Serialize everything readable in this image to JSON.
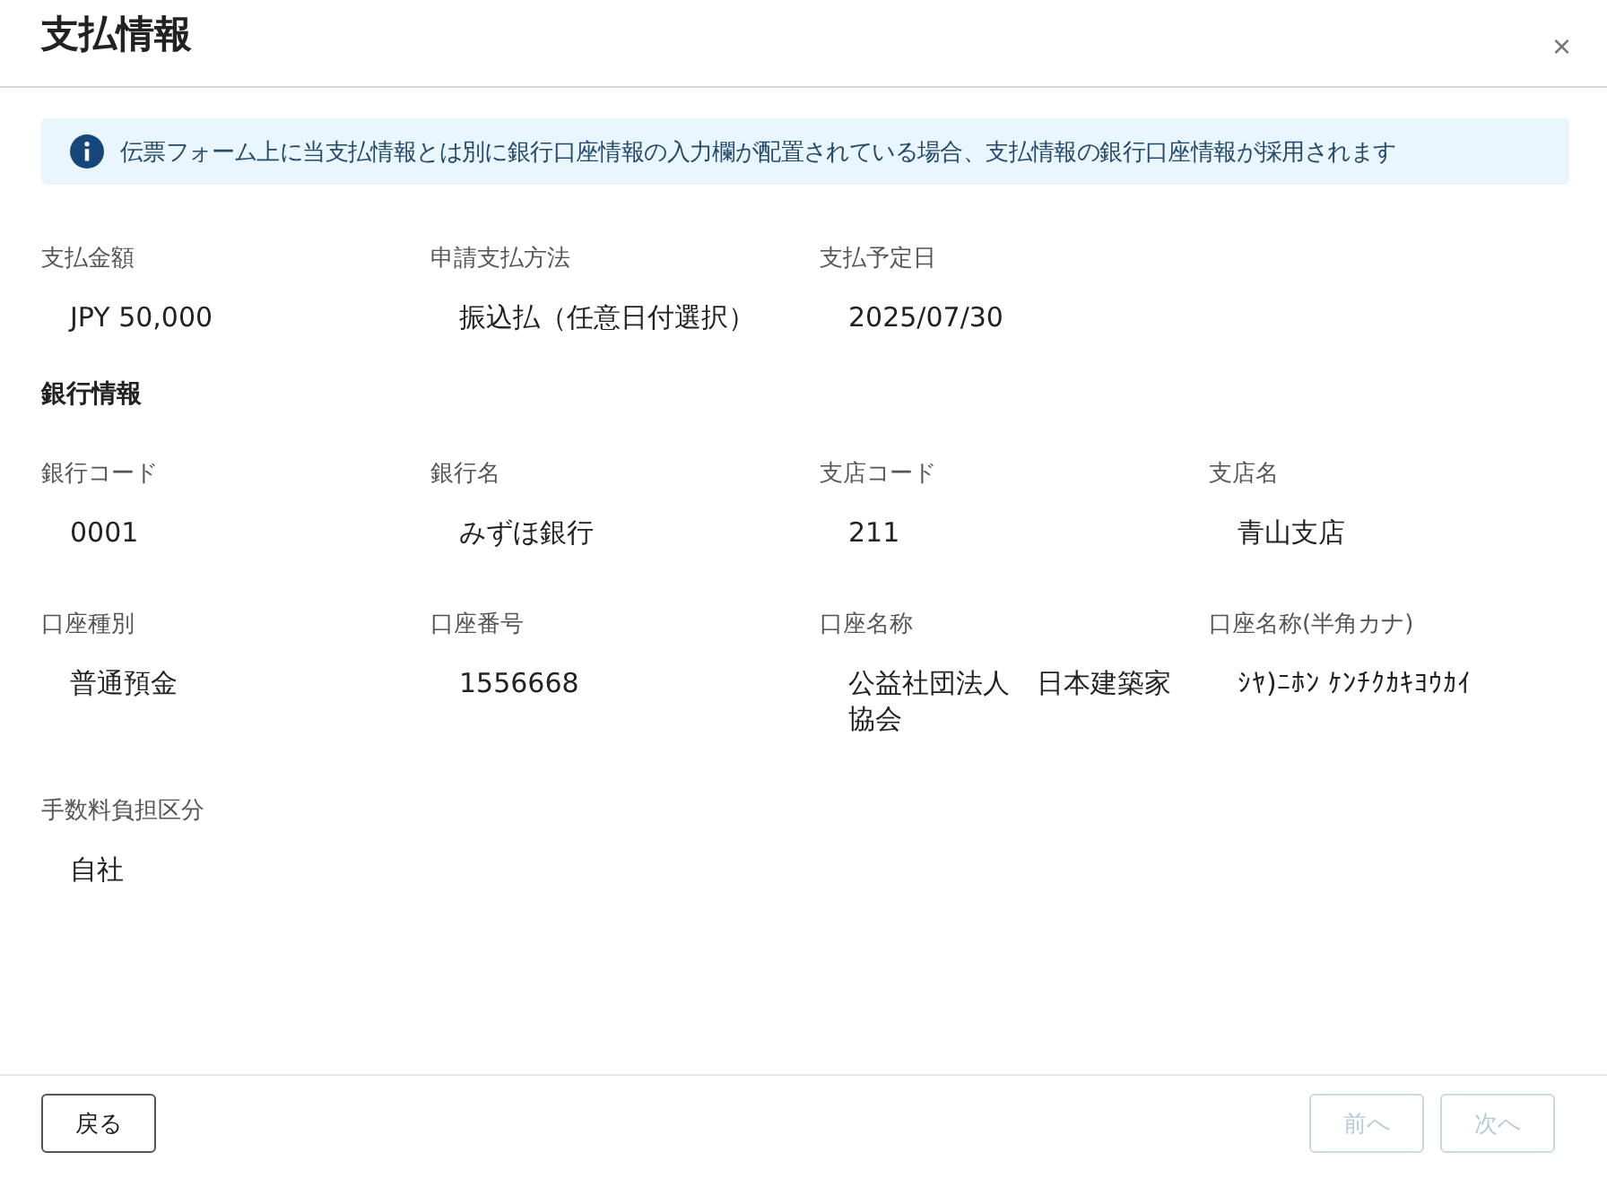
{
  "dialog": {
    "title": "支払情報",
    "close": "×"
  },
  "notice": {
    "text": "伝票フォーム上に当支払情報とは別に銀行口座情報の入力欄が配置されている場合、支払情報の銀行口座情報が採用されます"
  },
  "payment_fields": [
    {
      "label": "支払金額",
      "value": "JPY 50,000"
    },
    {
      "label": "申請支払方法",
      "value": "振込払（任意日付選択）"
    },
    {
      "label": "支払予定日",
      "value": "2025/07/30"
    }
  ],
  "bank_section": {
    "title": "銀行情報",
    "rows": [
      [
        {
          "label": "銀行コード",
          "value": "0001"
        },
        {
          "label": "銀行名",
          "value": "みずほ銀行"
        },
        {
          "label": "支店コード",
          "value": "211"
        },
        {
          "label": "支店名",
          "value": "青山支店"
        }
      ],
      [
        {
          "label": "口座種別",
          "value": "普通預金"
        },
        {
          "label": "口座番号",
          "value": "1556668"
        },
        {
          "label": "口座名称",
          "value": "公益社団法人　日本建築家協会"
        },
        {
          "label": "口座名称(半角カナ)",
          "value": "ｼﾔ)ﾆﾎﾝ ｹﾝﾁｸｶｷﾖｳｶｲ"
        }
      ],
      [
        {
          "label": "手数料負担区分",
          "value": "自社"
        }
      ]
    ]
  },
  "footer": {
    "back": {
      "label": "戻る",
      "disabled": false
    },
    "nav": [
      {
        "label": "前へ",
        "disabled": true
      },
      {
        "label": "次へ",
        "disabled": true
      }
    ]
  }
}
